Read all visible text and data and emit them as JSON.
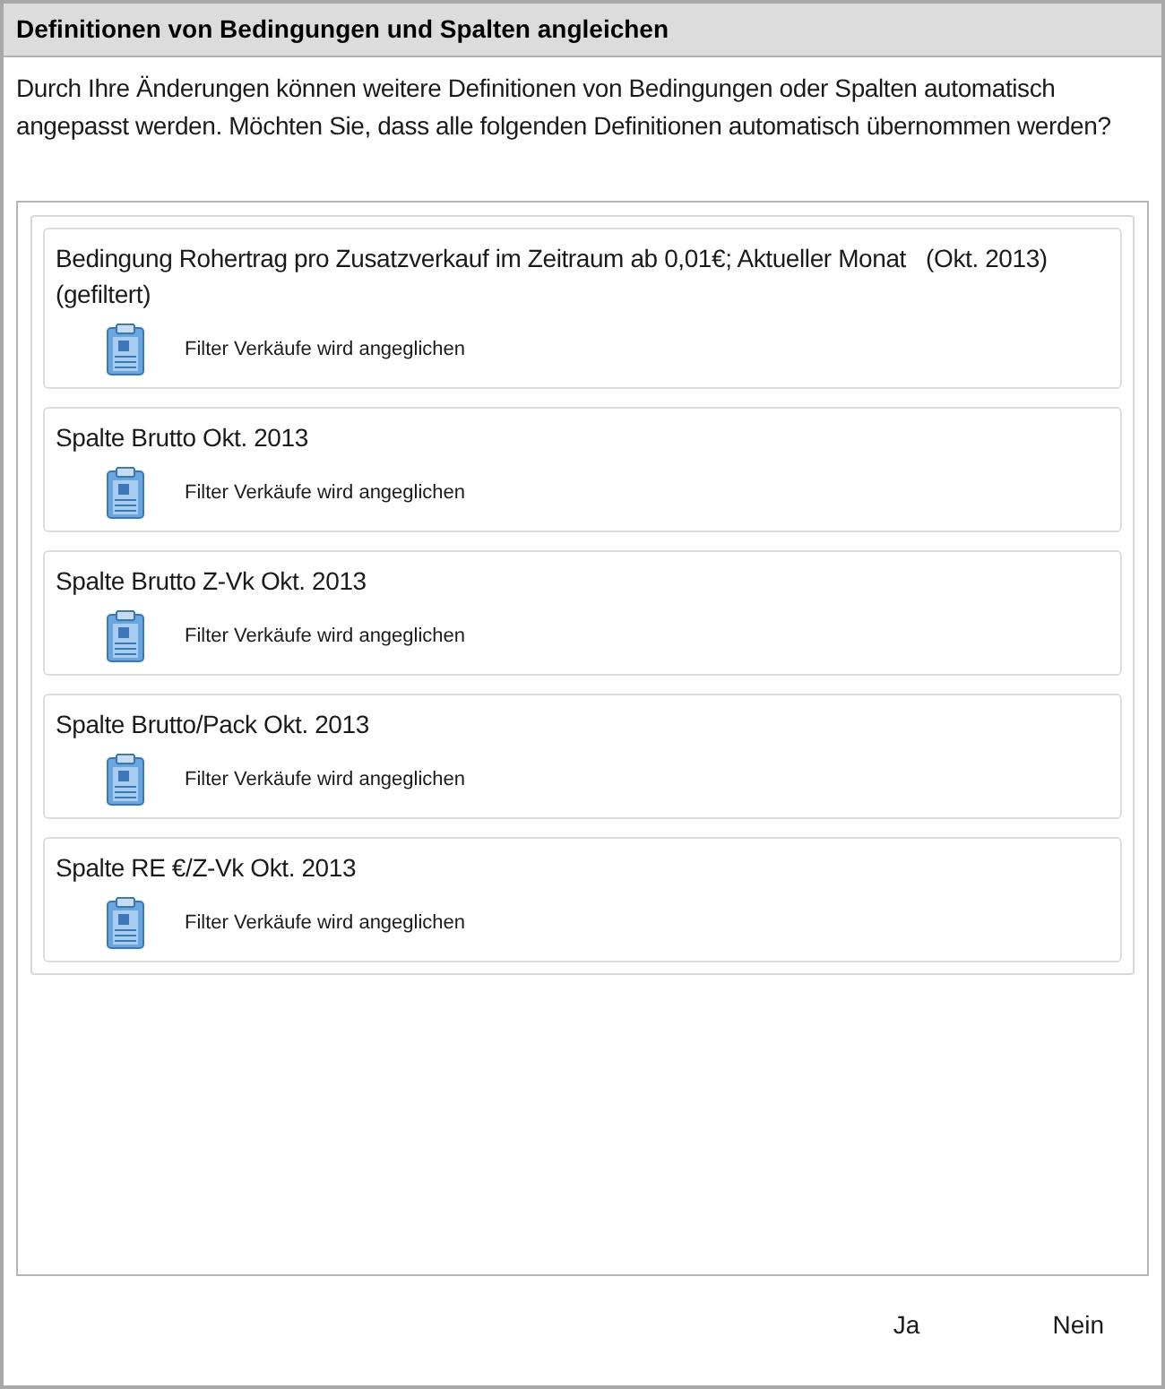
{
  "window": {
    "title": "Definitionen von Bedingungen und Spalten angleichen"
  },
  "message": "Durch Ihre Änderungen können weitere Definitionen von Bedingungen oder Spalten automatisch angepasst werden. Möchten Sie, dass alle folgenden Definitionen automatisch übernommen werden?",
  "items": [
    {
      "title": "Bedingung Rohertrag pro Zusatzverkauf im Zeitraum ab 0,01€; Aktueller Monat   (Okt. 2013) (gefiltert)",
      "detail": "Filter Verkäufe wird angeglichen"
    },
    {
      "title": "Spalte Brutto Okt. 2013",
      "detail": "Filter Verkäufe wird angeglichen"
    },
    {
      "title": "Spalte Brutto Z-Vk Okt. 2013",
      "detail": "Filter Verkäufe wird angeglichen"
    },
    {
      "title": "Spalte Brutto/Pack Okt. 2013",
      "detail": "Filter Verkäufe wird angeglichen"
    },
    {
      "title": "Spalte RE €/Z-Vk Okt. 2013",
      "detail": "Filter Verkäufe wird angeglichen"
    }
  ],
  "buttons": [
    "Ja",
    "Nein"
  ]
}
